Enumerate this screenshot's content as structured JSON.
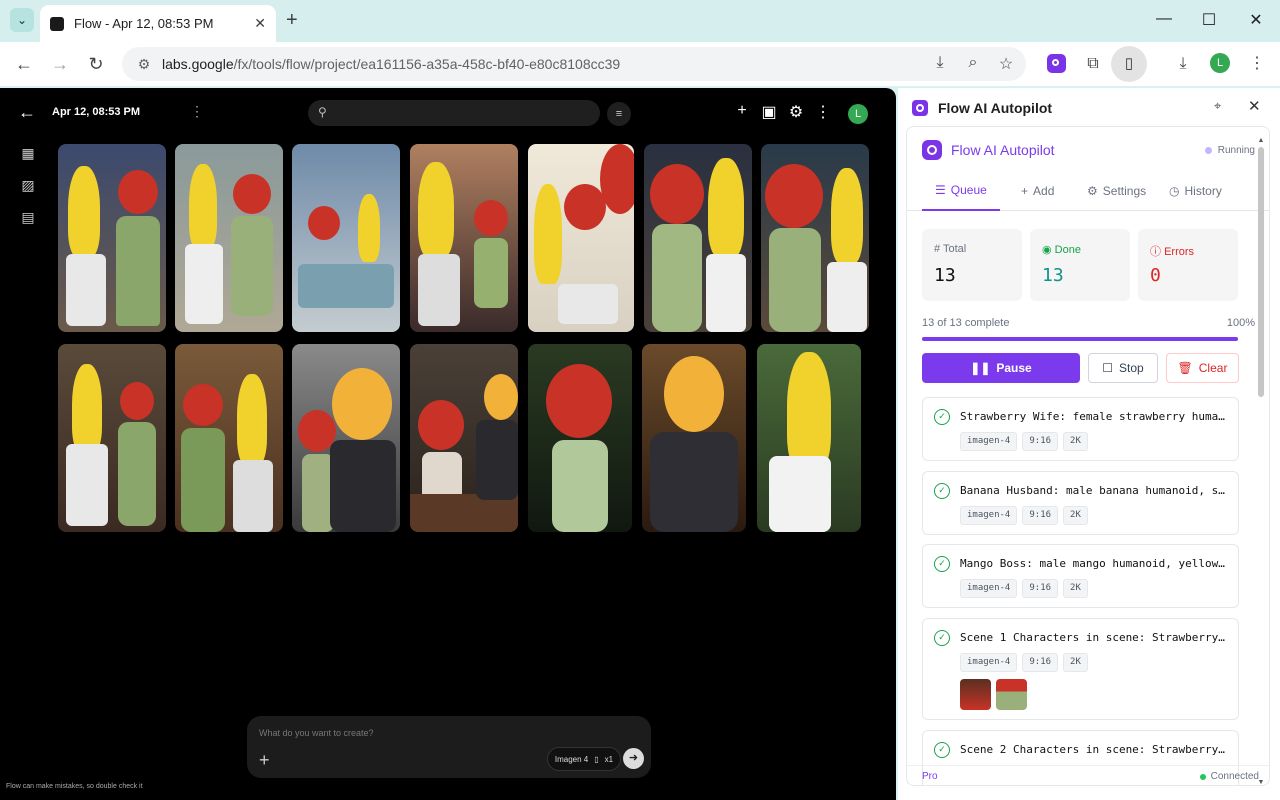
{
  "browser": {
    "tab_title": "Flow - Apr 12, 08:53 PM",
    "url_host": "labs.google",
    "url_path": "/fx/tools/flow/project/ea161156-a35a-458c-bf40-e80c8108cc39",
    "profile_initial": "L",
    "icons": [
      "tab-menu-icon",
      "back-icon",
      "forward-icon",
      "reload-icon",
      "site-settings-icon",
      "download-icon",
      "zoom-icon",
      "star-icon",
      "extensions-icon",
      "side-panel-icon",
      "more-icon"
    ]
  },
  "flow": {
    "date_label": "Apr 12, 08:53 PM",
    "avatar_initial": "L",
    "prompt_placeholder": "What do you want to create?",
    "model_label": "Imagen 4",
    "count_label": "x1",
    "disclaimer": "Flow can make mistakes, so double check it",
    "grid_images": 14
  },
  "panel": {
    "header_title": "Flow AI Autopilot",
    "ext_title": "Flow AI Autopilot",
    "status": "Running",
    "tabs": [
      {
        "label": "Queue",
        "icon": "list-icon",
        "active": true
      },
      {
        "label": "Add",
        "icon": "plus-icon",
        "active": false
      },
      {
        "label": "Settings",
        "icon": "gear-icon",
        "active": false
      },
      {
        "label": "History",
        "icon": "history-icon",
        "active": false
      }
    ],
    "stats": {
      "total": {
        "label": "Total",
        "value": "13"
      },
      "done": {
        "label": "Done",
        "value": "13"
      },
      "errors": {
        "label": "Errors",
        "value": "0"
      }
    },
    "progress": {
      "text": "13 of 13 complete",
      "percent_label": "100%",
      "fraction": 1.0
    },
    "buttons": {
      "pause": "Pause",
      "stop": "Stop",
      "clear": "Clear"
    },
    "queue": [
      {
        "text": "Strawberry Wife: female strawberry huma…",
        "chips": [
          "imagen-4",
          "9:16",
          "2K"
        ]
      },
      {
        "text": "Banana Husband: male banana humanoid, s…",
        "chips": [
          "imagen-4",
          "9:16",
          "2K"
        ]
      },
      {
        "text": "Mango Boss: male mango humanoid, yellow…",
        "chips": [
          "imagen-4",
          "9:16",
          "2K"
        ]
      },
      {
        "text": "Scene 1 Characters in scene: Strawberry…",
        "chips": [
          "imagen-4",
          "9:16",
          "2K"
        ]
      },
      {
        "text": "Scene 2 Characters in scene: Strawberry…",
        "chips": []
      }
    ],
    "footer": {
      "plan": "Pro",
      "connection": "Connected"
    },
    "colors": {
      "accent": "#7c3aed",
      "done": "#16a34a",
      "error": "#dc2626"
    }
  }
}
